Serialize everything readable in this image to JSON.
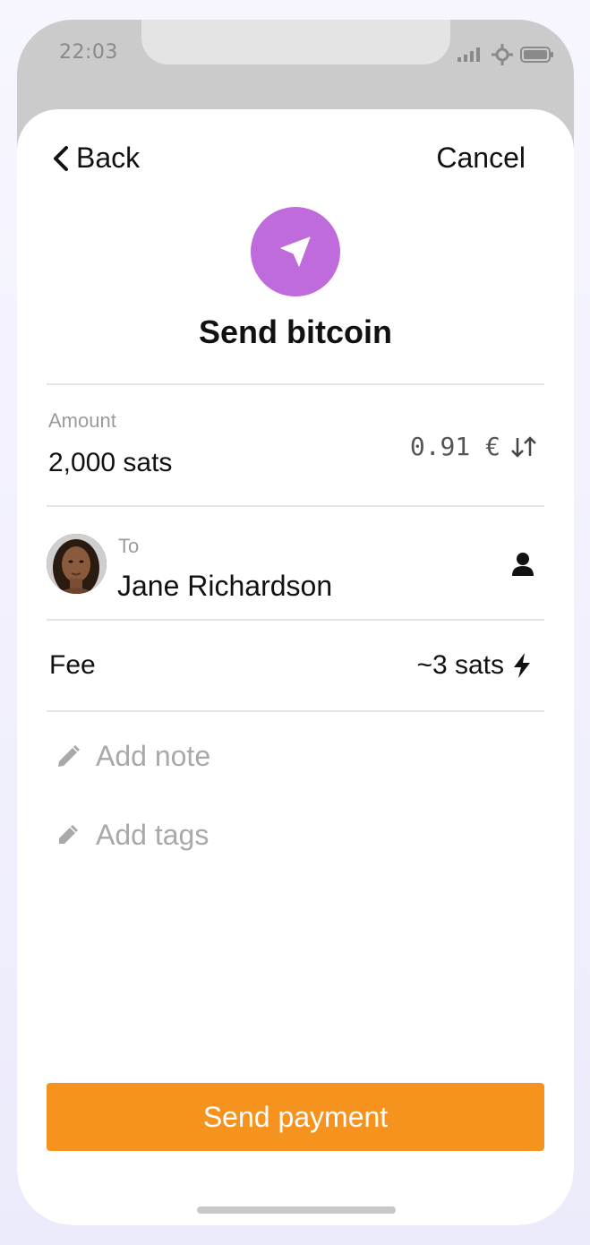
{
  "status_bar": {
    "time": "22:03"
  },
  "nav": {
    "back_label": "Back",
    "cancel_label": "Cancel"
  },
  "header": {
    "icon": "send-arrow-icon",
    "title": "Send bitcoin",
    "icon_color": "#c06bdc"
  },
  "amount": {
    "label": "Amount",
    "value": "2,000 sats",
    "fiat_value": "0.91 €",
    "swap_icon": "swap-arrows-icon"
  },
  "recipient": {
    "label": "To",
    "name": "Jane Richardson",
    "contact_icon": "person-icon"
  },
  "fee": {
    "label": "Fee",
    "value": "~3  sats",
    "icon": "lightning-icon"
  },
  "note": {
    "placeholder": "Add note",
    "icon": "pencil-icon"
  },
  "tags": {
    "placeholder": "Add tags",
    "icon": "tag-pencil-icon"
  },
  "send_button": {
    "label": "Send payment",
    "color": "#f5931e"
  }
}
